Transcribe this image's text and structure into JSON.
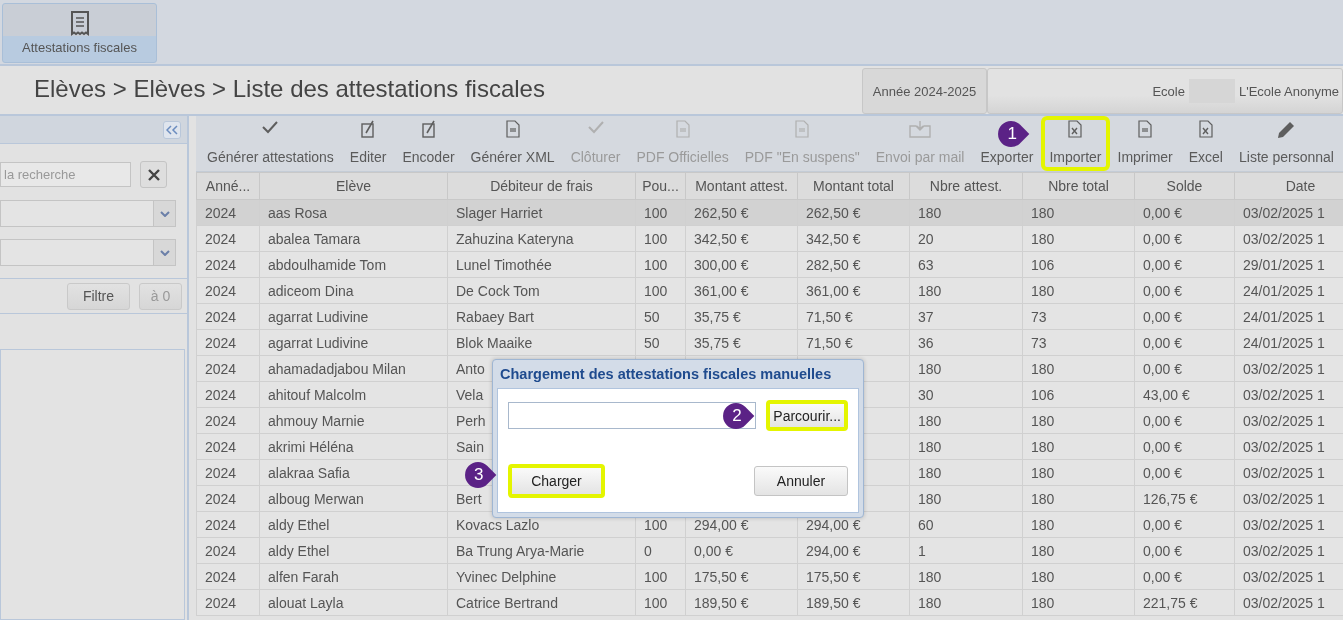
{
  "top_tabs": [
    {
      "label": "Attestations fiscales",
      "selected": true
    }
  ],
  "breadcrumb": "Elèves > Elèves > Liste des attestations fiscales",
  "year": "Année 2024-2025",
  "school": {
    "label": "Ecole",
    "name": "L'Ecole Anonyme"
  },
  "left_panel": {
    "search": {
      "placeholder": "la recherche"
    },
    "filter_buttons": [
      {
        "label": "Filtre",
        "disabled": false
      },
      {
        "label": "à 0",
        "disabled": true
      }
    ]
  },
  "toolbar": [
    {
      "label": "Générer attestations",
      "kind": "check",
      "disabled": false,
      "highlighted": false
    },
    {
      "label": "Editer",
      "kind": "edit",
      "disabled": false,
      "highlighted": false
    },
    {
      "label": "Encoder",
      "kind": "edit",
      "disabled": false,
      "highlighted": false
    },
    {
      "label": "Générer XML",
      "kind": "document",
      "disabled": false,
      "highlighted": false
    },
    {
      "label": "Clôturer",
      "kind": "check",
      "disabled": true,
      "highlighted": false
    },
    {
      "label": "PDF Officielles",
      "kind": "document",
      "disabled": true,
      "highlighted": false
    },
    {
      "label": "PDF \"En suspens\"",
      "kind": "document",
      "disabled": true,
      "highlighted": false
    },
    {
      "label": "Envoi par mail",
      "kind": "inbox",
      "disabled": true,
      "highlighted": false
    },
    {
      "label": "Exporter",
      "kind": "plain",
      "disabled": false,
      "highlighted": false
    },
    {
      "label": "Importer",
      "kind": "sheet",
      "disabled": false,
      "highlighted": true,
      "callout": "1"
    },
    {
      "label": "Imprimer",
      "kind": "document",
      "disabled": false,
      "highlighted": false
    },
    {
      "label": "Excel",
      "kind": "sheet",
      "disabled": false,
      "highlighted": false
    },
    {
      "label": "Liste personnal",
      "kind": "pencil",
      "disabled": false,
      "highlighted": false
    }
  ],
  "table": {
    "columns": [
      "Anné...",
      "Elève",
      "Débiteur de frais",
      "Pou...",
      "Montant attest.",
      "Montant total",
      "Nbre attest.",
      "Nbre total",
      "Solde",
      "Date"
    ],
    "rows": [
      {
        "selected": true,
        "cells": [
          "2024",
          "aas Rosa",
          "Slager Harriet",
          "100",
          "262,50 €",
          "262,50 €",
          "180",
          "180",
          "0,00 €",
          "03/02/2025 1"
        ]
      },
      {
        "selected": false,
        "cells": [
          "2024",
          "abalea Tamara",
          "Zahuzina Kateryna",
          "100",
          "342,50 €",
          "342,50 €",
          "20",
          "180",
          "0,00 €",
          "03/02/2025 1"
        ]
      },
      {
        "selected": false,
        "cells": [
          "2024",
          "abdoulhamide Tom",
          "Lunel Timothée",
          "100",
          "300,00 €",
          "282,50 €",
          "63",
          "106",
          "0,00 €",
          "29/01/2025 1"
        ]
      },
      {
        "selected": false,
        "cells": [
          "2024",
          "adiceom Dina",
          "De Cock Tom",
          "100",
          "361,00 €",
          "361,00 €",
          "180",
          "180",
          "0,00 €",
          "24/01/2025 1"
        ]
      },
      {
        "selected": false,
        "cells": [
          "2024",
          "agarrat Ludivine",
          "Rabaey Bart",
          "50",
          "35,75 €",
          "71,50 €",
          "37",
          "73",
          "0,00 €",
          "24/01/2025 1"
        ]
      },
      {
        "selected": false,
        "cells": [
          "2024",
          "agarrat Ludivine",
          "Blok Maaike",
          "50",
          "35,75 €",
          "71,50 €",
          "36",
          "73",
          "0,00 €",
          "24/01/2025 1"
        ]
      },
      {
        "selected": false,
        "cells": [
          "2024",
          "ahamadadjabou Milan",
          "Anto",
          null,
          null,
          null,
          "180",
          "180",
          "0,00 €",
          "03/02/2025 1"
        ]
      },
      {
        "selected": false,
        "cells": [
          "2024",
          "ahitouf Malcolm",
          "Vela",
          null,
          null,
          null,
          "30",
          "106",
          "43,00 €",
          "03/02/2025 1"
        ]
      },
      {
        "selected": false,
        "cells": [
          "2024",
          "ahmouy Marnie",
          "Perh",
          null,
          null,
          null,
          "180",
          "180",
          "0,00 €",
          "03/02/2025 1"
        ]
      },
      {
        "selected": false,
        "cells": [
          "2024",
          "akrimi Héléna",
          "Sain",
          null,
          null,
          null,
          "180",
          "180",
          "0,00 €",
          "03/02/2025 1"
        ]
      },
      {
        "selected": false,
        "cells": [
          "2024",
          "alakraa Safia",
          null,
          null,
          null,
          null,
          "180",
          "180",
          "0,00 €",
          "03/02/2025 1"
        ]
      },
      {
        "selected": false,
        "cells": [
          "2024",
          "alboug Merwan",
          "Bert",
          null,
          null,
          null,
          "180",
          "180",
          "126,75 €",
          "03/02/2025 1"
        ]
      },
      {
        "selected": false,
        "cells": [
          "2024",
          "aldy Ethel",
          "Kovacs Lazlo",
          "100",
          "294,00 €",
          "294,00 €",
          "60",
          "180",
          "0,00 €",
          "03/02/2025 1"
        ]
      },
      {
        "selected": false,
        "cells": [
          "2024",
          "aldy Ethel",
          "Ba Trung Arya-Marie",
          "0",
          "0,00 €",
          "294,00 €",
          "1",
          "180",
          "0,00 €",
          "03/02/2025 1"
        ]
      },
      {
        "selected": false,
        "cells": [
          "2024",
          "alfen Farah",
          "Yvinec Delphine",
          "100",
          "175,50 €",
          "175,50 €",
          "180",
          "180",
          "0,00 €",
          "03/02/2025 1"
        ]
      },
      {
        "selected": false,
        "cells": [
          "2024",
          "alouat Layla",
          "Catrice Bertrand",
          "100",
          "189,50 €",
          "189,50 €",
          "180",
          "180",
          "221,75 €",
          "03/02/2025 1"
        ]
      }
    ]
  },
  "dialog": {
    "title": "Chargement des attestations fiscales manuelles",
    "browse": {
      "label": "Parcourir...",
      "highlighted": true,
      "callout": "2"
    },
    "buttons": [
      {
        "label": "Charger",
        "highlighted": true,
        "callout": "3"
      },
      {
        "label": "Annuler",
        "highlighted": false
      }
    ]
  }
}
